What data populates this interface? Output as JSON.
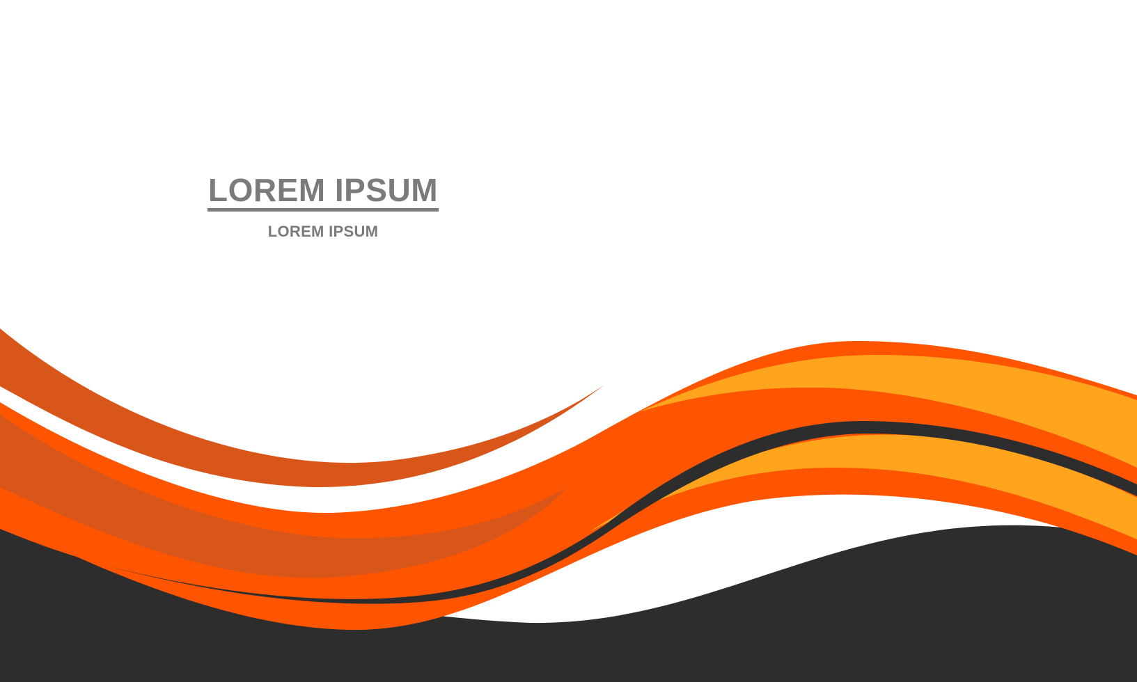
{
  "text": {
    "headline": "LOREM IPSUM",
    "subline": "LOREM IPSUM"
  },
  "colors": {
    "background": "#ffffff",
    "text_gray": "#7b7b7b",
    "dark_gray": "#2d2d2d",
    "orange": "#ff5500",
    "burnt_orange": "#d9561a",
    "amber": "#ffa51d"
  }
}
